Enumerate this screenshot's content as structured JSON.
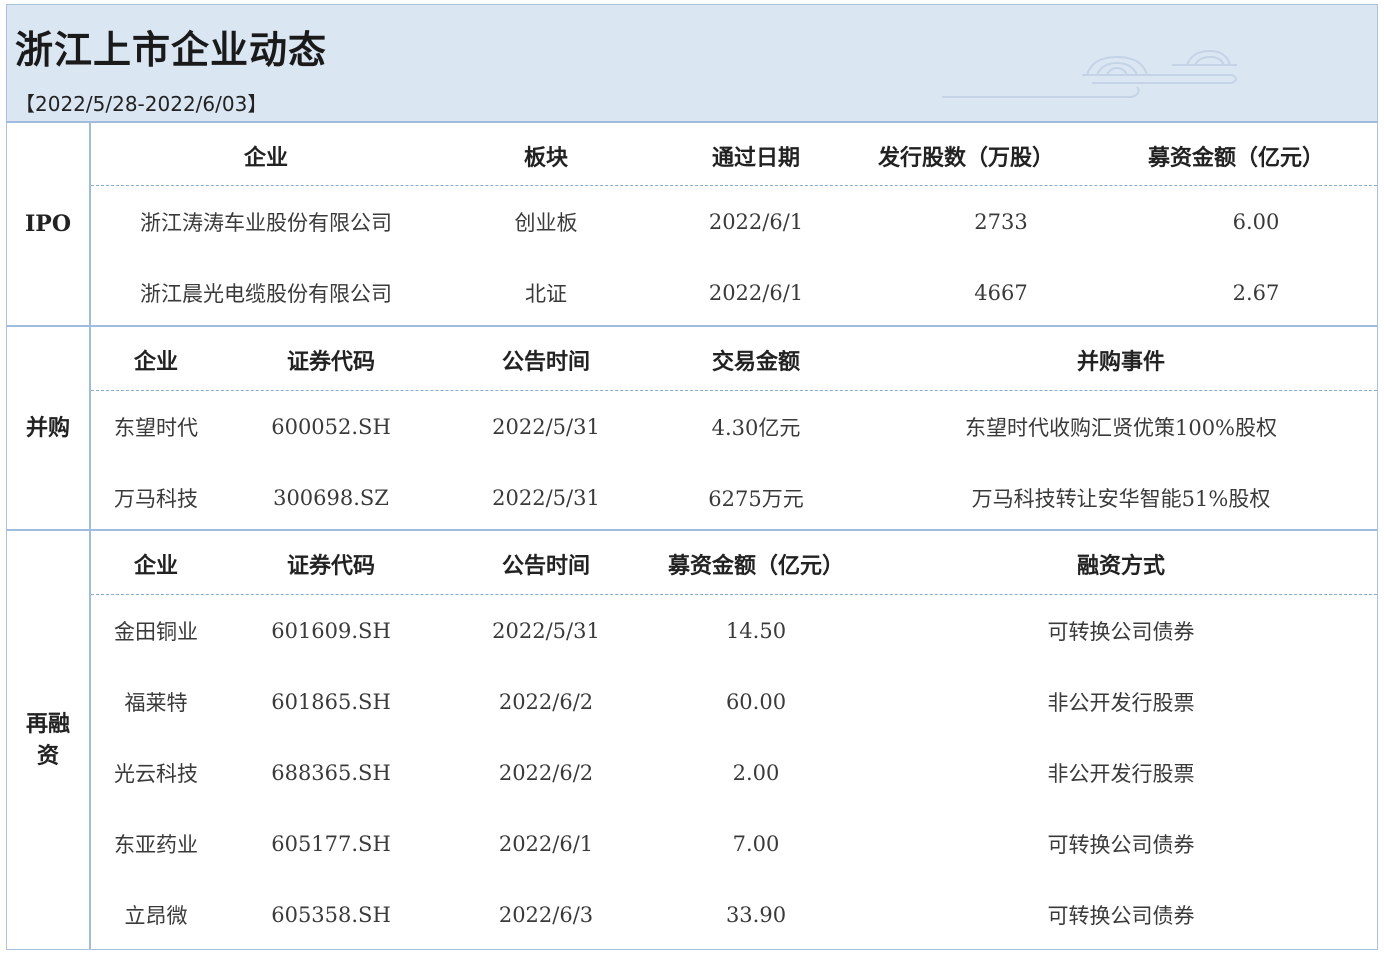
{
  "header": {
    "title": "浙江上市企业动态",
    "date_range": "【2022/5/28-2022/6/03】"
  },
  "ipo": {
    "label": "IPO",
    "columns": [
      "企业",
      "板块",
      "通过日期",
      "发行股数（万股）",
      "募资金额（亿元）"
    ],
    "rows": [
      [
        "浙江涛涛车业股份有限公司",
        "创业板",
        "2022/6/1",
        "2733",
        "6.00"
      ],
      [
        "浙江晨光电缆股份有限公司",
        "北证",
        "2022/6/1",
        "4667",
        "2.67"
      ]
    ]
  },
  "ma": {
    "label": "并购",
    "columns": [
      "企业",
      "证券代码",
      "公告时间",
      "交易金额",
      "并购事件"
    ],
    "rows": [
      [
        "东望时代",
        "600052.SH",
        "2022/5/31",
        "4.30亿元",
        "东望时代收购汇贤优策100%股权"
      ],
      [
        "万马科技",
        "300698.SZ",
        "2022/5/31",
        "6275万元",
        "万马科技转让安华智能51%股权"
      ]
    ]
  },
  "refinance": {
    "label": "再融资",
    "columns": [
      "企业",
      "证券代码",
      "公告时间",
      "募资金额（亿元）",
      "融资方式"
    ],
    "rows": [
      [
        "金田铜业",
        "601609.SH",
        "2022/5/31",
        "14.50",
        "可转换公司债券"
      ],
      [
        "福莱特",
        "601865.SH",
        "2022/6/2",
        "60.00",
        "非公开发行股票"
      ],
      [
        "光云科技",
        "688365.SH",
        "2022/6/2",
        "2.00",
        "非公开发行股票"
      ],
      [
        "东亚药业",
        "605177.SH",
        "2022/6/1",
        "7.00",
        "可转换公司债券"
      ],
      [
        "立昂微",
        "605358.SH",
        "2022/6/3",
        "33.90",
        "可转换公司债券"
      ]
    ]
  },
  "colors": {
    "header_bg": "#dbe6f3",
    "border": "#9fbcde",
    "dashed": "#8aaad0"
  }
}
